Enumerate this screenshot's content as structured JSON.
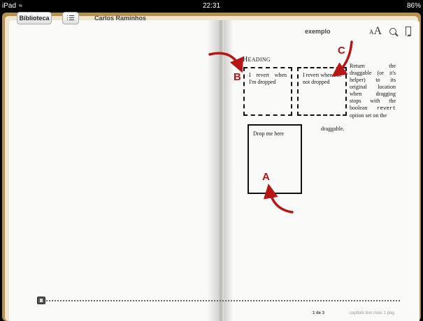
{
  "status_bar": {
    "device": "iPad",
    "time": "22:31",
    "battery": "86%"
  },
  "toolbar": {
    "library_label": "Biblioteca",
    "toc_icon": "list-icon",
    "author": "Carlos Raminhos",
    "title": "exemplo",
    "font_icon": "font-size-icon",
    "font_small": "A",
    "font_big": "A",
    "search_icon": "search-icon",
    "bookmark_icon": "bookmark-icon"
  },
  "content": {
    "heading_cap": "H",
    "heading_rest": "EADING",
    "box_b_text": "I revert when I'm dropped",
    "box_c_text": "I revert when I'm not dropped",
    "side_text_1": "Return the draggable (or it's helper) to its original location when dragging stops with the boolean",
    "side_code": "revert",
    "side_text_2": "option set on the",
    "side_tail": "draggable.",
    "drop_text": "Drop me here"
  },
  "markers": {
    "a": "A",
    "b": "B",
    "c": "C",
    "color": "#b81616"
  },
  "footer": {
    "page_indicator": "1 de 3",
    "pages_left": "capítulo tem mais 1 pág."
  },
  "colors": {
    "cover": "#b7914f",
    "page": "#fafaf9"
  }
}
